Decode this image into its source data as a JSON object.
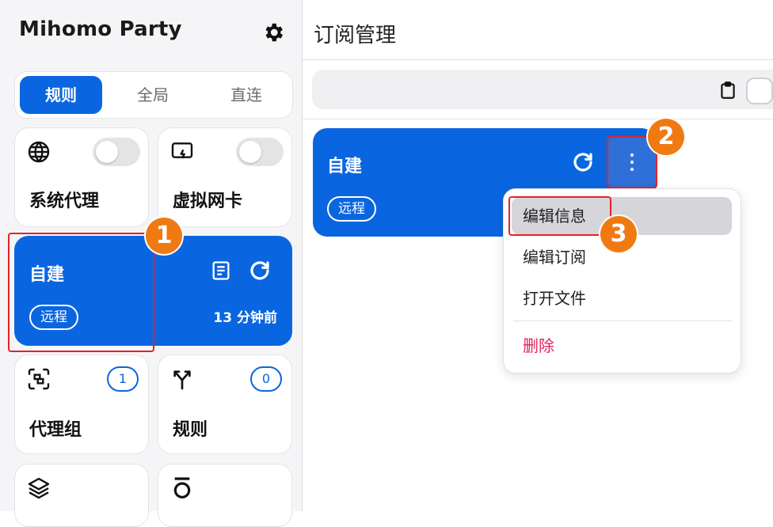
{
  "app": {
    "name": "Mihomo Party"
  },
  "sidebar": {
    "modes": [
      "规则",
      "全局",
      "直连"
    ],
    "active_mode": "规则",
    "sysproxy": {
      "label": "系统代理",
      "enabled": false
    },
    "tun": {
      "label": "虚拟网卡",
      "enabled": false
    },
    "profile": {
      "name": "自建",
      "tag": "远程",
      "updated": "13 分钟前"
    },
    "proxy_groups": {
      "label": "代理组",
      "count": "1"
    },
    "rules": {
      "label": "规则",
      "count": "0"
    }
  },
  "main": {
    "title": "订阅管理",
    "subscription": {
      "name": "自建",
      "tag": "远程"
    },
    "menu": {
      "items": [
        "编辑信息",
        "编辑订阅",
        "打开文件",
        "删除"
      ]
    }
  },
  "annotations": {
    "markers": [
      "1",
      "2",
      "3"
    ],
    "color": "#f07a12",
    "box_color": "#e0242a"
  },
  "colors": {
    "accent": "#0a66e0",
    "danger": "#e0245e"
  }
}
